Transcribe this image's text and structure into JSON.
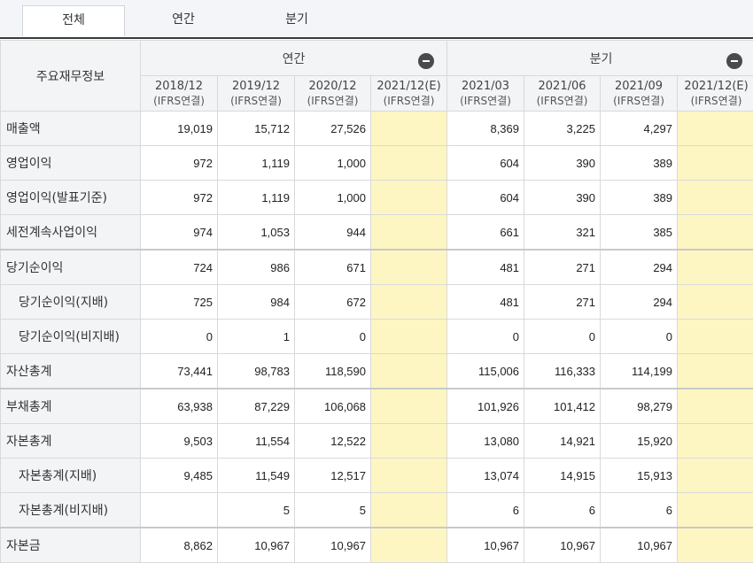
{
  "tabs": [
    {
      "label": "전체",
      "active": true
    },
    {
      "label": "연간",
      "active": false
    },
    {
      "label": "분기",
      "active": false
    }
  ],
  "table": {
    "corner_label": "주요재무정보",
    "groups": [
      {
        "label": "연간"
      },
      {
        "label": "분기"
      }
    ],
    "periods": [
      {
        "date": "2018/12",
        "basis": "(IFRS연결)"
      },
      {
        "date": "2019/12",
        "basis": "(IFRS연결)"
      },
      {
        "date": "2020/12",
        "basis": "(IFRS연결)"
      },
      {
        "date": "2021/12(E)",
        "basis": "(IFRS연결)"
      },
      {
        "date": "2021/03",
        "basis": "(IFRS연결)"
      },
      {
        "date": "2021/06",
        "basis": "(IFRS연결)"
      },
      {
        "date": "2021/09",
        "basis": "(IFRS연결)"
      },
      {
        "date": "2021/12(E)",
        "basis": "(IFRS연결)"
      }
    ],
    "rows": [
      {
        "label": "매출액",
        "values": [
          "19,019",
          "15,712",
          "27,526",
          "",
          "8,369",
          "3,225",
          "4,297",
          ""
        ]
      },
      {
        "label": "영업이익",
        "values": [
          "972",
          "1,119",
          "1,000",
          "",
          "604",
          "390",
          "389",
          ""
        ]
      },
      {
        "label": "영업이익(발표기준)",
        "values": [
          "972",
          "1,119",
          "1,000",
          "",
          "604",
          "390",
          "389",
          ""
        ]
      },
      {
        "label": "세전계속사업이익",
        "values": [
          "974",
          "1,053",
          "944",
          "",
          "661",
          "321",
          "385",
          ""
        ]
      },
      {
        "label": "당기순이익",
        "values": [
          "724",
          "986",
          "671",
          "",
          "481",
          "271",
          "294",
          ""
        ]
      },
      {
        "label": "당기순이익(지배)",
        "values": [
          "725",
          "984",
          "672",
          "",
          "481",
          "271",
          "294",
          ""
        ]
      },
      {
        "label": "당기순이익(비지배)",
        "values": [
          "0",
          "1",
          "0",
          "",
          "0",
          "0",
          "0",
          ""
        ]
      },
      {
        "label": "자산총계",
        "values": [
          "73,441",
          "98,783",
          "118,590",
          "",
          "115,006",
          "116,333",
          "114,199",
          ""
        ]
      },
      {
        "label": "부채총계",
        "values": [
          "63,938",
          "87,229",
          "106,068",
          "",
          "101,926",
          "101,412",
          "98,279",
          ""
        ]
      },
      {
        "label": "자본총계",
        "values": [
          "9,503",
          "11,554",
          "12,522",
          "",
          "13,080",
          "14,921",
          "15,920",
          ""
        ]
      },
      {
        "label": "자본총계(지배)",
        "values": [
          "9,485",
          "11,549",
          "12,517",
          "",
          "13,074",
          "14,915",
          "15,913",
          ""
        ]
      },
      {
        "label": "자본총계(비지배)",
        "values": [
          "",
          "5",
          "5",
          "",
          "6",
          "6",
          "6",
          ""
        ]
      },
      {
        "label": "자본금",
        "values": [
          "8,862",
          "10,967",
          "10,967",
          "",
          "10,967",
          "10,967",
          "10,967",
          ""
        ]
      }
    ]
  },
  "colors": {
    "estimate_cell": "#fdf6c2",
    "header_bg": "#f3f4f6"
  }
}
